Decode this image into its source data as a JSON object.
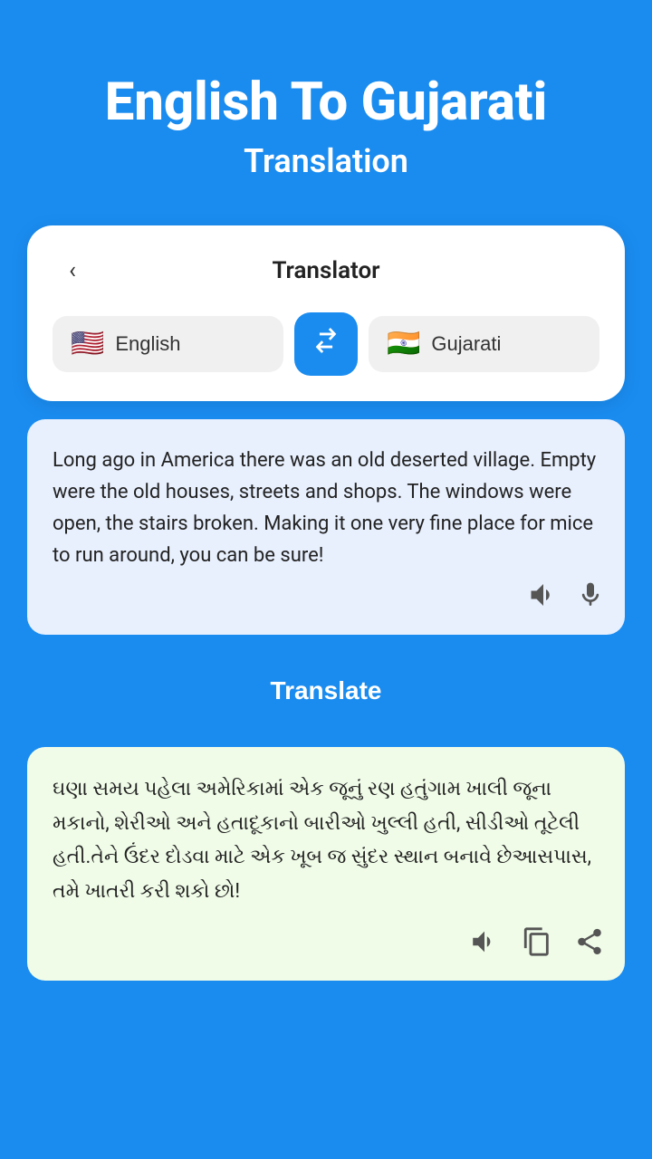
{
  "header": {
    "title": "English To Gujarati",
    "subtitle": "Translation"
  },
  "translator_card": {
    "back_label": "‹",
    "title": "Translator"
  },
  "languages": {
    "source": {
      "name": "English",
      "flag": "🇺🇸"
    },
    "target": {
      "name": "Gujarati",
      "flag": "🇮🇳"
    },
    "swap_icon": "⇄"
  },
  "input": {
    "text": "Long ago in America there was an old deserted village. Empty were the old houses, streets and shops. The windows were open, the stairs broken. Making it one very fine place for mice to run around, you can be sure!"
  },
  "output": {
    "text": "ઘણા સમય પહેલા અમેરિકામાં એક જૂનું રણ હતુંગામ ખાલી જૂના મકાનો, શેરીઓ અને હતાદૂકાનો બારીઓ ખુલ્લી હતી, સીડીઓ તૂટેલી હતી.તેને ઉંદર દોડવા માટે એક ખૂબ જ સુંદર સ્થાન બનાવે છેઆસપાસ, તમે ખાતરી કરી શકો છો!"
  },
  "buttons": {
    "translate": "Translate"
  },
  "icons": {
    "speaker": "🔊",
    "microphone": "🎤",
    "copy": "⧉",
    "share": "⤴"
  }
}
